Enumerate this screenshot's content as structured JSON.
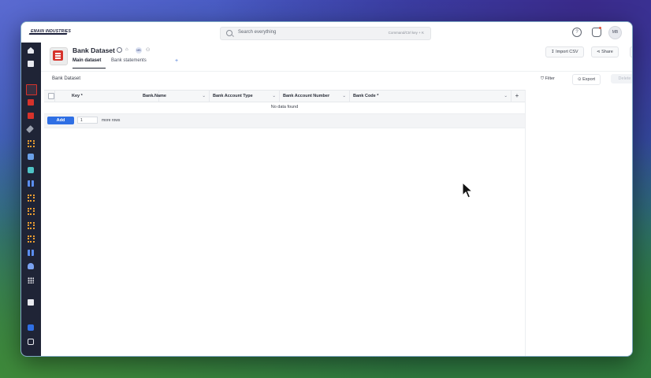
{
  "topbar": {
    "logo_text": "EMAIN INDUSTRIES",
    "search_placeholder": "Search everything",
    "search_shortcut": "Command/Ctrl key + K",
    "user_initials": "MB"
  },
  "page": {
    "title": "Bank Dataset",
    "title_badge": "MB",
    "tabs": [
      {
        "label": "Main dataset",
        "active": true
      },
      {
        "label": "Bank statements",
        "active": false
      }
    ],
    "tab_add": "+",
    "import_label": "Import CSV",
    "share_label": "Share",
    "more_label": "•••"
  },
  "grid_toolbar": {
    "section_title": "Bank Dataset",
    "filter_label": "Filter",
    "export_label": "Export",
    "delete_label": "Delete"
  },
  "grid": {
    "columns": [
      "Key *",
      "Bank Name",
      "Bank Account Type",
      "Bank Account Number",
      "Bank Code *"
    ],
    "empty_text": "No data found",
    "add_label": "Add",
    "rows_value": "1",
    "more_rows_label": "more rows",
    "add_column": "+"
  },
  "colors": {
    "sidebar_bg": "#1f2436",
    "accent": "#2f6fe4",
    "dataset_icon": "#d6322b"
  },
  "sidebar_icons": [
    "home-icon",
    "inbox-icon",
    "dataset-icon",
    "dataset-icon",
    "dataset-icon",
    "wrench-icon",
    "workflow-icon",
    "app-icon",
    "app-icon",
    "grid-icon",
    "workflow-icon",
    "workflow-icon",
    "workflow-icon",
    "workflow-icon",
    "grid-icon",
    "bot-icon",
    "apps-icon",
    "chart-icon",
    "user-icon",
    "lock-icon"
  ]
}
